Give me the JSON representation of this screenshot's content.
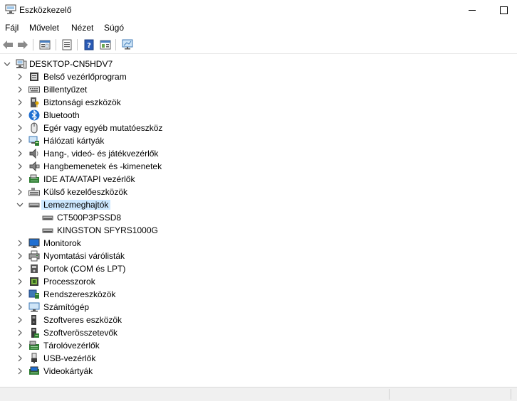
{
  "window": {
    "title": "Eszközkezelő"
  },
  "menu": [
    "Fájl",
    "Művelet",
    "Nézet",
    "Súgó"
  ],
  "toolbar": {
    "buttons": [
      "back-icon",
      "forward-icon",
      "properties-icon",
      "update-driver-icon",
      "help-icon",
      "action-icon",
      "monitor-scan-icon"
    ]
  },
  "tree": {
    "root": "DESKTOP-CN5HDV7",
    "categories": [
      {
        "label": "Belső vezérlőprogram",
        "icon": "firmware-icon"
      },
      {
        "label": "Billentyűzet",
        "icon": "keyboard-icon"
      },
      {
        "label": "Biztonsági eszközök",
        "icon": "security-device-icon"
      },
      {
        "label": "Bluetooth",
        "icon": "bluetooth-icon"
      },
      {
        "label": "Egér vagy egyéb mutatóeszköz",
        "icon": "mouse-icon"
      },
      {
        "label": "Hálózati kártyák",
        "icon": "network-adapter-icon"
      },
      {
        "label": "Hang-, videó- és játékvezérlők",
        "icon": "speaker-icon"
      },
      {
        "label": "Hangbemenetek és -kimenetek",
        "icon": "audio-io-icon"
      },
      {
        "label": "IDE ATA/ATAPI vezérlők",
        "icon": "ide-controller-icon"
      },
      {
        "label": "Külső kezelőeszközök",
        "icon": "hid-icon"
      },
      {
        "label": "Lemezmeghajtók",
        "icon": "disk-drive-icon",
        "expanded": true,
        "selected": true,
        "children": [
          "CT500P3PSSD8",
          "KINGSTON SFYRS1000G"
        ]
      },
      {
        "label": "Monitorok",
        "icon": "monitor-icon"
      },
      {
        "label": "Nyomtatási várólisták",
        "icon": "printer-icon"
      },
      {
        "label": "Portok (COM és LPT)",
        "icon": "port-icon"
      },
      {
        "label": "Processzorok",
        "icon": "processor-icon"
      },
      {
        "label": "Rendszereszközök",
        "icon": "system-device-icon"
      },
      {
        "label": "Számítógép",
        "icon": "computer-icon"
      },
      {
        "label": "Szoftveres eszközök",
        "icon": "software-device-icon"
      },
      {
        "label": "Szoftverösszetevők",
        "icon": "software-component-icon"
      },
      {
        "label": "Tárolóvezérlők",
        "icon": "storage-controller-icon"
      },
      {
        "label": "USB-vezérlők",
        "icon": "usb-icon"
      },
      {
        "label": "Videokártyák",
        "icon": "display-adapter-icon"
      }
    ]
  }
}
